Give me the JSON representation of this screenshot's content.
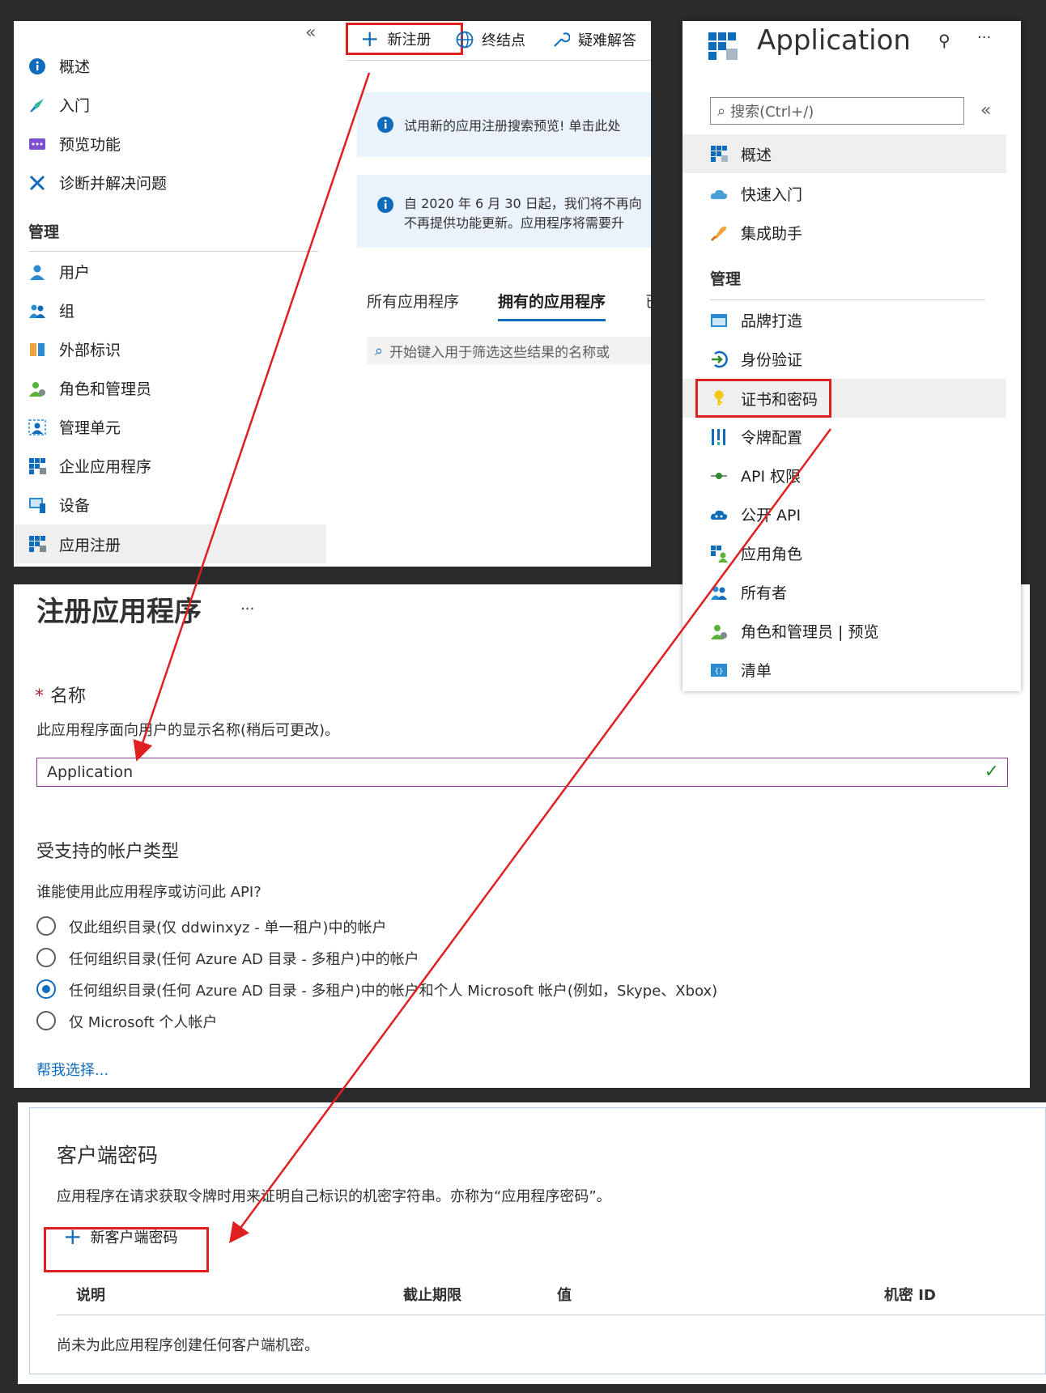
{
  "left_menu": {
    "collapse": "«",
    "items": [
      {
        "label": "概述",
        "icon": "info-icon"
      },
      {
        "label": "入门",
        "icon": "rocket-icon"
      },
      {
        "label": "预览功能",
        "icon": "preview-icon"
      },
      {
        "label": "诊断并解决问题",
        "icon": "wrench-icon"
      }
    ],
    "section": "管理",
    "manage_items": [
      {
        "label": "用户",
        "icon": "user-icon"
      },
      {
        "label": "组",
        "icon": "group-icon"
      },
      {
        "label": "外部标识",
        "icon": "external-id-icon"
      },
      {
        "label": "角色和管理员",
        "icon": "roles-icon"
      },
      {
        "label": "管理单元",
        "icon": "admin-unit-icon"
      },
      {
        "label": "企业应用程序",
        "icon": "enterprise-apps-icon"
      },
      {
        "label": "设备",
        "icon": "device-icon"
      },
      {
        "label": "应用注册",
        "icon": "app-reg-icon"
      }
    ]
  },
  "appreg": {
    "toolbar": {
      "new_reg": "新注册",
      "endpoints": "终结点",
      "troubleshoot": "疑难解答"
    },
    "notice1": "试用新的应用注册搜索预览! 单击此处",
    "notice2_l1": "自 2020 年 6 月 30 日起，我们将不再向",
    "notice2_l2": "不再提供功能更新。应用程序将需要升",
    "tabs": [
      "所有应用程序",
      "拥有的应用程序",
      "已"
    ],
    "filter_placeholder": "开始键入用于筛选这些结果的名称或",
    "red_color": "#e02020"
  },
  "app_blade": {
    "title": "Application",
    "search_placeholder": "搜索(Ctrl+/)",
    "collapse": "«",
    "items": [
      {
        "label": "概述",
        "icon": "app-grid-icon"
      },
      {
        "label": "快速入门",
        "icon": "cloud-icon"
      },
      {
        "label": "集成助手",
        "icon": "rocket-icon"
      }
    ],
    "section": "管理",
    "manage_items": [
      {
        "label": "品牌打造",
        "icon": "branding-icon"
      },
      {
        "label": "身份验证",
        "icon": "auth-icon"
      },
      {
        "label": "证书和密码",
        "icon": "key-icon"
      },
      {
        "label": "令牌配置",
        "icon": "token-icon"
      },
      {
        "label": "API 权限",
        "icon": "api-perm-icon"
      },
      {
        "label": "公开 API",
        "icon": "expose-api-icon"
      },
      {
        "label": "应用角色",
        "icon": "app-roles-icon"
      },
      {
        "label": "所有者",
        "icon": "owners-icon"
      },
      {
        "label": "角色和管理员 | 预览",
        "icon": "roles-icon"
      },
      {
        "label": "清单",
        "icon": "manifest-icon"
      }
    ]
  },
  "register": {
    "title": "注册应用程序",
    "ellipsis": "···",
    "required_mark": "*",
    "name_label": "名称",
    "name_help": "此应用程序面向用户的显示名称(稍后可更改)。",
    "name_value": "Application",
    "acct_title": "受支持的帐户类型",
    "acct_question": "谁能使用此应用程序或访问此 API?",
    "options": [
      {
        "label": "仅此组织目录(仅 ddwinxyz - 单一租户)中的帐户",
        "selected": false
      },
      {
        "label": "任何组织目录(任何 Azure AD 目录 - 多租户)中的帐户",
        "selected": false
      },
      {
        "label": "任何组织目录(任何 Azure AD 目录 - 多租户)中的帐户和个人 Microsoft 帐户(例如，Skype、Xbox)",
        "selected": true
      },
      {
        "label": "仅 Microsoft 个人帐户",
        "selected": false
      }
    ],
    "help_link": "帮我选择..."
  },
  "secret": {
    "title": "客户端密码",
    "desc": "应用程序在请求获取令牌时用来证明自己标识的机密字符串。亦称为“应用程序密码”。",
    "new_button": "新客户端密码",
    "columns": [
      "说明",
      "截止期限",
      "值",
      "机密 ID"
    ],
    "empty": "尚未为此应用程序创建任何客户端机密。"
  }
}
